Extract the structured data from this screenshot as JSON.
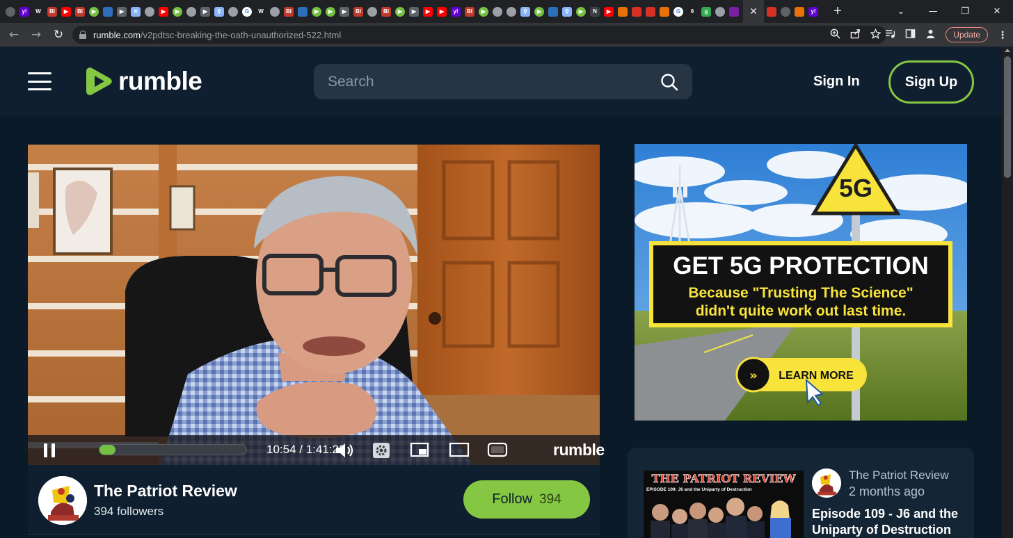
{
  "browser": {
    "active_tab_close": "✕",
    "new_tab": "+",
    "window_controls": [
      "⌄",
      "—",
      "❐",
      "✕"
    ],
    "url_host": "rumble.com",
    "url_path": "/v2pdtsc-breaking-the-oath-unauthorized-522.html",
    "update_label": "Update",
    "tab_favicons": [
      {
        "icon": "chrome-icon",
        "color": "#5f6368",
        "text": ""
      },
      {
        "icon": "yahoo-icon",
        "color": "#6001d2",
        "text": "y!"
      },
      {
        "icon": "wiki-icon",
        "color": "#202124",
        "text": "W"
      },
      {
        "icon": "bi-icon",
        "color": "#c0392b",
        "text": "BI"
      },
      {
        "icon": "youtube-icon",
        "color": "#ff0000",
        "text": "▶"
      },
      {
        "icon": "bi-icon",
        "color": "#c0392b",
        "text": "BI"
      },
      {
        "icon": "rumble-icon",
        "color": "#75c043",
        "text": "▶"
      },
      {
        "icon": "vpn-icon",
        "color": "#2c6fbb",
        "text": ""
      },
      {
        "icon": "play-icon",
        "color": "#5f6368",
        "text": "▶"
      },
      {
        "icon": "x-icon",
        "color": "#8ab4f8",
        "text": "✕"
      },
      {
        "icon": "globe-icon",
        "color": "#9aa0a6",
        "text": ""
      },
      {
        "icon": "youtube-icon",
        "color": "#ff0000",
        "text": "▶"
      },
      {
        "icon": "rumble-icon",
        "color": "#75c043",
        "text": "▶"
      },
      {
        "icon": "globe-icon",
        "color": "#9aa0a6",
        "text": ""
      },
      {
        "icon": "play-icon",
        "color": "#5f6368",
        "text": "▶"
      },
      {
        "icon": "search-icon",
        "color": "#8ab4f8",
        "text": "⚲"
      },
      {
        "icon": "globe-icon",
        "color": "#9aa0a6",
        "text": ""
      },
      {
        "icon": "google-icon",
        "color": "#ffffff",
        "text": "G"
      },
      {
        "icon": "wiki-icon",
        "color": "#202124",
        "text": "W"
      },
      {
        "icon": "globe-icon",
        "color": "#9aa0a6",
        "text": ""
      },
      {
        "icon": "bi-icon",
        "color": "#c0392b",
        "text": "BI"
      },
      {
        "icon": "vpn-icon",
        "color": "#2c6fbb",
        "text": ""
      },
      {
        "icon": "rumble-icon",
        "color": "#75c043",
        "text": "▶"
      },
      {
        "icon": "rumble-icon",
        "color": "#75c043",
        "text": "▶"
      },
      {
        "icon": "play-icon",
        "color": "#5f6368",
        "text": "▶"
      },
      {
        "icon": "bi-icon",
        "color": "#c0392b",
        "text": "BI"
      },
      {
        "icon": "globe-icon",
        "color": "#9aa0a6",
        "text": ""
      },
      {
        "icon": "bi-icon",
        "color": "#c0392b",
        "text": "BI"
      },
      {
        "icon": "rumble-icon",
        "color": "#75c043",
        "text": "▶"
      },
      {
        "icon": "play-icon",
        "color": "#5f6368",
        "text": "▶"
      },
      {
        "icon": "youtube-icon",
        "color": "#ff0000",
        "text": "▶"
      },
      {
        "icon": "youtube-icon",
        "color": "#ff0000",
        "text": "▶"
      },
      {
        "icon": "yahoo-icon",
        "color": "#6001d2",
        "text": "y!"
      },
      {
        "icon": "bi-icon",
        "color": "#c0392b",
        "text": "BI"
      },
      {
        "icon": "rumble-icon",
        "color": "#75c043",
        "text": "▶"
      },
      {
        "icon": "globe-icon",
        "color": "#9aa0a6",
        "text": ""
      },
      {
        "icon": "globe-icon",
        "color": "#9aa0a6",
        "text": ""
      },
      {
        "icon": "search-icon",
        "color": "#8ab4f8",
        "text": "⚲"
      },
      {
        "icon": "rumble-icon",
        "color": "#75c043",
        "text": "▶"
      },
      {
        "icon": "vpn-icon",
        "color": "#2c6fbb",
        "text": ""
      },
      {
        "icon": "search-icon",
        "color": "#8ab4f8",
        "text": "⚲"
      },
      {
        "icon": "rumble-icon",
        "color": "#75c043",
        "text": "▶"
      },
      {
        "icon": "news-icon",
        "color": "#3c4043",
        "text": "N"
      },
      {
        "icon": "youtube-icon",
        "color": "#ff0000",
        "text": "▶"
      },
      {
        "icon": "bookmark-icon",
        "color": "#e8710a",
        "text": ""
      },
      {
        "icon": "mic-icon",
        "color": "#d93025",
        "text": ""
      },
      {
        "icon": "mic-icon",
        "color": "#d93025",
        "text": ""
      },
      {
        "icon": "bookmark-icon",
        "color": "#e8710a",
        "text": ""
      },
      {
        "icon": "google-icon",
        "color": "#ffffff",
        "text": "G"
      },
      {
        "icon": "theta-icon",
        "color": "#202124",
        "text": "θ"
      },
      {
        "icon": "g-icon",
        "color": "#34a853",
        "text": "g"
      },
      {
        "icon": "globe-icon",
        "color": "#9aa0a6",
        "text": ""
      },
      {
        "icon": "purple-icon",
        "color": "#7b1fa2",
        "text": ""
      }
    ],
    "tab_favicons_after": [
      {
        "icon": "mic-icon",
        "color": "#d93025",
        "text": ""
      },
      {
        "icon": "person-icon",
        "color": "#5f6368",
        "text": ""
      },
      {
        "icon": "bookmark-icon",
        "color": "#e8710a",
        "text": ""
      },
      {
        "icon": "yahoo-icon",
        "color": "#6001d2",
        "text": "y!"
      }
    ]
  },
  "header": {
    "logo_text": "rumble",
    "search_placeholder": "Search",
    "sign_in": "Sign In",
    "sign_up": "Sign Up",
    "accent": "#85c742"
  },
  "player": {
    "time": "10:54 / 1:41:22",
    "progress": 0.107,
    "logo_text": "rumble"
  },
  "channel": {
    "name": "The Patriot Review",
    "followers": "394 followers",
    "follow_label": "Follow",
    "follow_count": "394"
  },
  "ad": {
    "sign_text": "5G",
    "headline": "GET 5G PROTECTION",
    "line1": "Because \"Trusting The Science\"",
    "line2": "didn't quite work out last time.",
    "cta": "LEARN MORE"
  },
  "related": {
    "thumb_title": "THE PATRIOT REVIEW",
    "thumb_subtitle": "EPISODE 109: J6 and the Uniparty of Destruction",
    "channel": "The Patriot Review",
    "time": "2 months ago",
    "title": "Episode 109 - J6 and the Uniparty of Destruction"
  }
}
